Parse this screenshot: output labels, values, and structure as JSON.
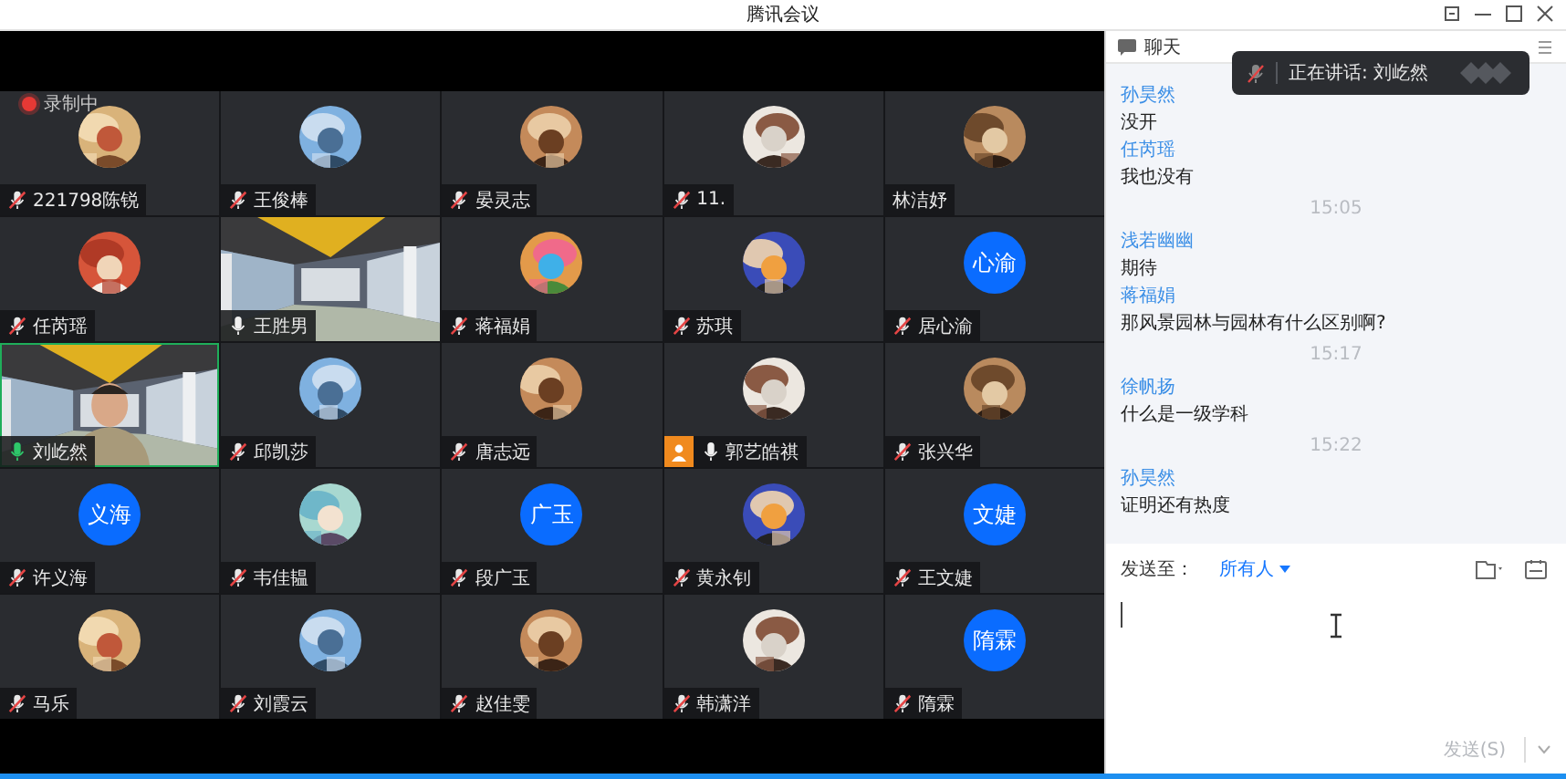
{
  "window": {
    "title": "腾讯会议"
  },
  "recording": {
    "label": "录制中"
  },
  "tiles": [
    {
      "name": "221798陈锐",
      "mic_shown": true,
      "muted": true,
      "speaking": false,
      "host": false
    },
    {
      "name": "王俊棒",
      "mic_shown": true,
      "muted": true,
      "speaking": false,
      "host": false
    },
    {
      "name": "晏灵志",
      "mic_shown": true,
      "muted": true,
      "speaking": false,
      "host": false
    },
    {
      "name": "11.",
      "mic_shown": true,
      "muted": true,
      "speaking": false,
      "host": false
    },
    {
      "name": "林洁妤",
      "mic_shown": false,
      "host": false
    },
    {
      "name": "任芮瑶",
      "mic_shown": true,
      "muted": true,
      "speaking": false,
      "host": false
    },
    {
      "name": "王胜男",
      "kind": "video",
      "mic_shown": true,
      "muted": false,
      "speaking": false,
      "host": false
    },
    {
      "name": "蒋福娟",
      "mic_shown": true,
      "muted": true,
      "speaking": false,
      "host": false
    },
    {
      "name": "苏琪",
      "mic_shown": true,
      "muted": true,
      "speaking": false,
      "host": false
    },
    {
      "name": "居心渝",
      "kind": "initials",
      "initials": "心渝",
      "mic_shown": true,
      "muted": true,
      "speaking": false,
      "host": false
    },
    {
      "name": "刘屹然",
      "kind": "video",
      "mic_shown": true,
      "muted": false,
      "speaking": true,
      "host": false
    },
    {
      "name": "邱凯莎",
      "mic_shown": true,
      "muted": true,
      "speaking": false,
      "host": false
    },
    {
      "name": "唐志远",
      "mic_shown": true,
      "muted": true,
      "speaking": false,
      "host": false
    },
    {
      "name": "郭艺皓祺",
      "mic_shown": true,
      "muted": false,
      "speaking": false,
      "host": true
    },
    {
      "name": "张兴华",
      "mic_shown": true,
      "muted": true,
      "speaking": false,
      "host": false
    },
    {
      "name": "许义海",
      "kind": "initials",
      "initials": "义海",
      "mic_shown": true,
      "muted": true,
      "speaking": false,
      "host": false
    },
    {
      "name": "韦佳韫",
      "mic_shown": true,
      "muted": true,
      "speaking": false,
      "host": false
    },
    {
      "name": "段广玉",
      "kind": "initials",
      "initials": "广玉",
      "mic_shown": true,
      "muted": true,
      "speaking": false,
      "host": false
    },
    {
      "name": "黄永钊",
      "mic_shown": true,
      "muted": true,
      "speaking": false,
      "host": false
    },
    {
      "name": "王文婕",
      "kind": "initials",
      "initials": "文婕",
      "mic_shown": true,
      "muted": true,
      "speaking": false,
      "host": false
    },
    {
      "name": "马乐",
      "mic_shown": true,
      "muted": true,
      "speaking": false,
      "host": false
    },
    {
      "name": "刘霞云",
      "mic_shown": true,
      "muted": true,
      "speaking": false,
      "host": false
    },
    {
      "name": "赵佳雯",
      "mic_shown": true,
      "muted": true,
      "speaking": false,
      "host": false
    },
    {
      "name": "韩潇洋",
      "mic_shown": true,
      "muted": true,
      "speaking": false,
      "host": false
    },
    {
      "name": "隋霖",
      "kind": "initials",
      "initials": "隋霖",
      "mic_shown": true,
      "muted": true,
      "speaking": false,
      "host": false
    }
  ],
  "chat": {
    "title": "聊天",
    "messages": [
      {
        "kind": "message",
        "sender": "孙昊然",
        "text": "没开"
      },
      {
        "kind": "message",
        "sender": "任芮瑶",
        "text": "我也没有"
      },
      {
        "kind": "time",
        "text": "15:05"
      },
      {
        "kind": "message",
        "sender": "浅若幽幽",
        "text": "期待"
      },
      {
        "kind": "message",
        "sender": "蒋福娟",
        "text": "那风景园林与园林有什么区别啊?"
      },
      {
        "kind": "time",
        "text": "15:17"
      },
      {
        "kind": "message",
        "sender": "徐帆扬",
        "text": "什么是一级学科"
      },
      {
        "kind": "time",
        "text": "15:22"
      },
      {
        "kind": "message",
        "sender": "孙昊然",
        "text": "证明还有热度"
      }
    ],
    "send_to_label": "发送至：",
    "recipient": "所有人",
    "send_button": {
      "label": "发送(S)",
      "disabled": true
    }
  },
  "speaking_toast": {
    "text": "正在讲话: 刘屹然"
  }
}
